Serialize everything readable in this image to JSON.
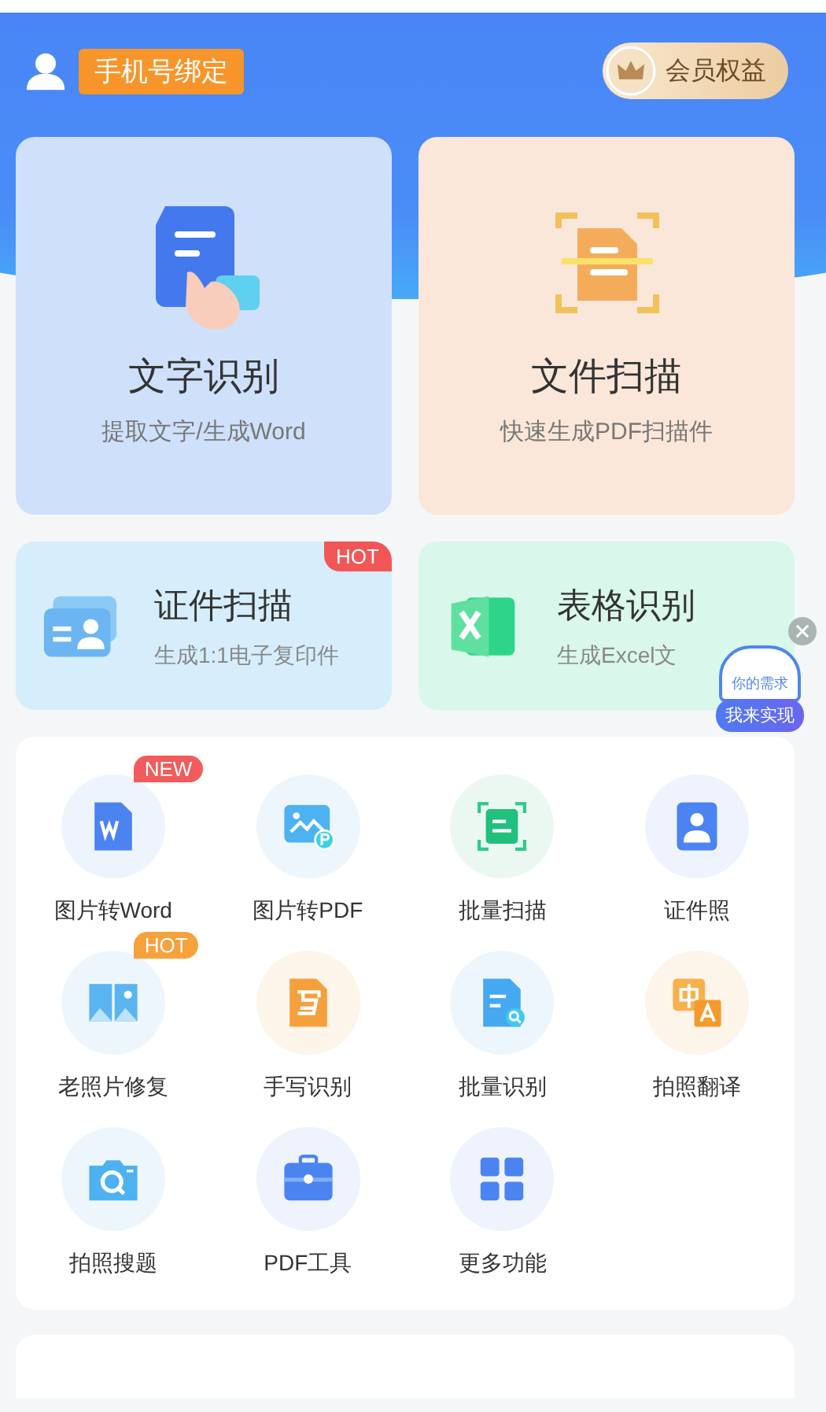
{
  "header": {
    "bind_phone": "手机号绑定",
    "vip": "会员权益"
  },
  "main_cards": [
    {
      "title": "文字识别",
      "subtitle": "提取文字/生成Word",
      "color": "#cfe0fb"
    },
    {
      "title": "文件扫描",
      "subtitle": "快速生成PDF扫描件",
      "color": "#fbe7da"
    }
  ],
  "feature_cards": [
    {
      "title": "证件扫描",
      "subtitle": "生成1:1电子复印件",
      "color": "#d6eefb",
      "badge": {
        "text": "HOT",
        "color": "#f25656"
      }
    },
    {
      "title": "表格识别",
      "subtitle": "生成Excel文",
      "color": "#d9f7ea"
    }
  ],
  "floating_widget": {
    "note": "你的需求",
    "label": "我来实现"
  },
  "tools": [
    {
      "label": "图片转Word",
      "badge": {
        "text": "NEW",
        "color": "#f25b5b"
      }
    },
    {
      "label": "图片转PDF"
    },
    {
      "label": "批量扫描"
    },
    {
      "label": "证件照"
    },
    {
      "label": "老照片修复",
      "badge": {
        "text": "HOT",
        "color": "#f5a23c"
      }
    },
    {
      "label": "手写识别"
    },
    {
      "label": "批量识别"
    },
    {
      "label": "拍照翻译"
    },
    {
      "label": "拍照搜题"
    },
    {
      "label": "PDF工具"
    },
    {
      "label": "更多功能"
    }
  ]
}
